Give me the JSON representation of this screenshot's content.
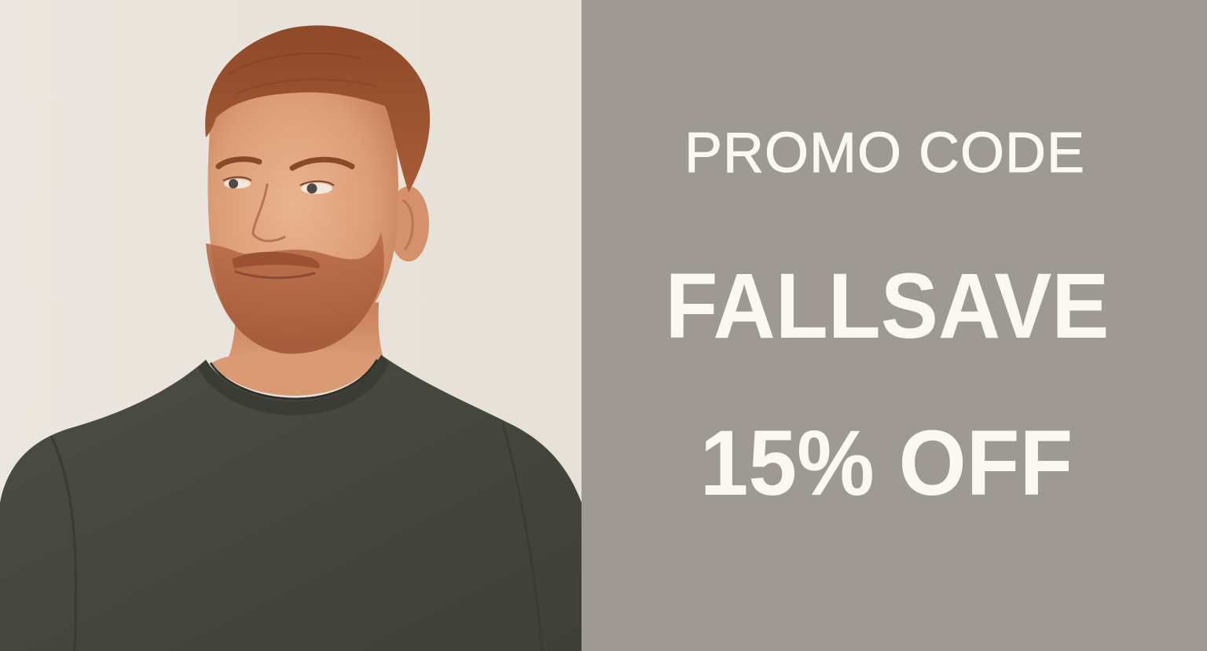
{
  "promo": {
    "label": "PROMO CODE",
    "code": "FALLSAVE",
    "discount": "15% OFF"
  },
  "colors": {
    "promo_panel_background": "#9e9a93",
    "promo_text": "#fbf8f1",
    "photo_background": "#ebe6df",
    "sweater": "#464840",
    "hair": "#9a5330",
    "skin": "#dfa37e"
  },
  "photo": {
    "subject": "smiling-man-in-dark-sweater"
  }
}
